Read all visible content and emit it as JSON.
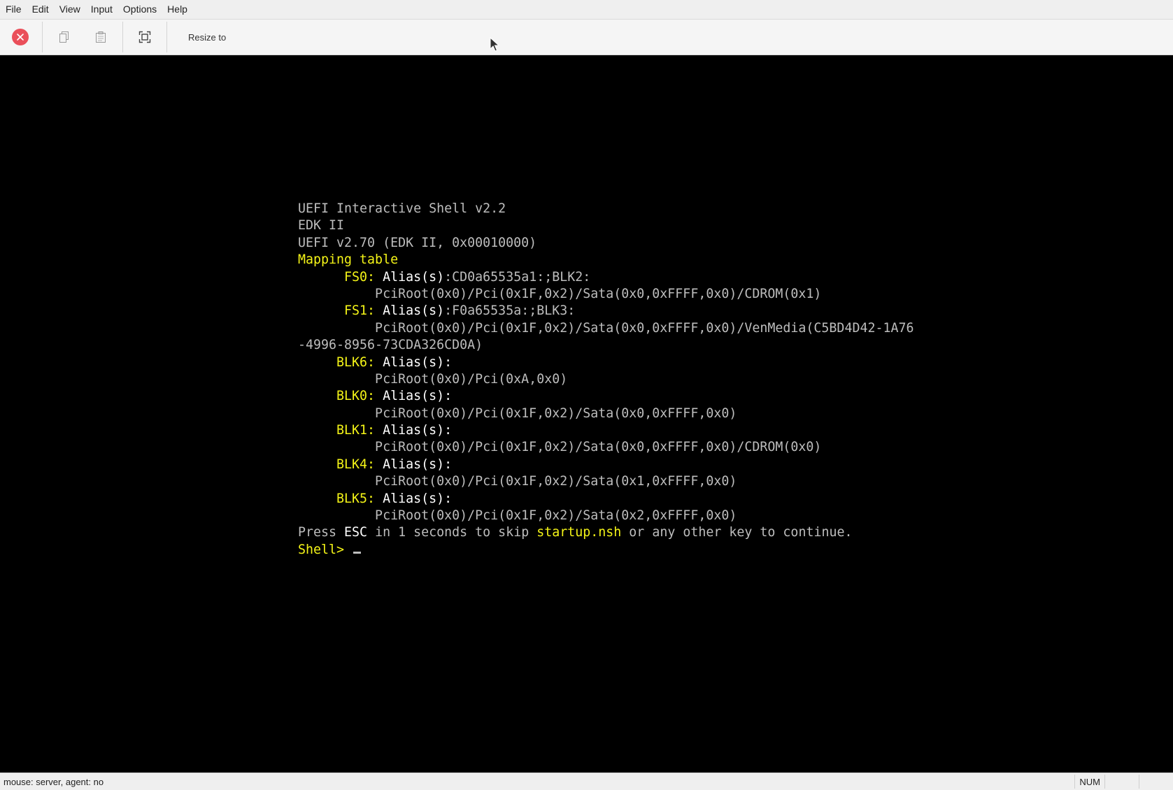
{
  "menubar": {
    "items": [
      "File",
      "Edit",
      "View",
      "Input",
      "Options",
      "Help"
    ]
  },
  "toolbar": {
    "resize_label": "Resize to"
  },
  "console": {
    "lines": [
      [
        {
          "t": "UEFI Interactive Shell v2.2",
          "c": "g"
        }
      ],
      [
        {
          "t": "EDK II",
          "c": "g"
        }
      ],
      [
        {
          "t": "UEFI v2.70 (EDK II, 0x00010000)",
          "c": "g"
        }
      ],
      [
        {
          "t": "Mapping table",
          "c": "y"
        }
      ],
      [
        {
          "t": "      FS0: ",
          "c": "y"
        },
        {
          "t": "Alias(s)",
          "c": "w"
        },
        {
          "t": ":CD0a65535a1:;BLK2:",
          "c": "g"
        }
      ],
      [
        {
          "t": "          PciRoot(0x0)/Pci(0x1F,0x2)/Sata(0x0,0xFFFF,0x0)/CDROM(0x1)",
          "c": "g"
        }
      ],
      [
        {
          "t": "      FS1: ",
          "c": "y"
        },
        {
          "t": "Alias(s)",
          "c": "w"
        },
        {
          "t": ":F0a65535a:;BLK3:",
          "c": "g"
        }
      ],
      [
        {
          "t": "          PciRoot(0x0)/Pci(0x1F,0x2)/Sata(0x0,0xFFFF,0x0)/VenMedia(C5BD4D42-1A76",
          "c": "g"
        }
      ],
      [
        {
          "t": "-4996-8956-73CDA326CD0A)",
          "c": "g"
        }
      ],
      [
        {
          "t": "     BLK6: ",
          "c": "y"
        },
        {
          "t": "Alias(s):",
          "c": "w"
        }
      ],
      [
        {
          "t": "          PciRoot(0x0)/Pci(0xA,0x0)",
          "c": "g"
        }
      ],
      [
        {
          "t": "     BLK0: ",
          "c": "y"
        },
        {
          "t": "Alias(s):",
          "c": "w"
        }
      ],
      [
        {
          "t": "          PciRoot(0x0)/Pci(0x1F,0x2)/Sata(0x0,0xFFFF,0x0)",
          "c": "g"
        }
      ],
      [
        {
          "t": "     BLK1: ",
          "c": "y"
        },
        {
          "t": "Alias(s):",
          "c": "w"
        }
      ],
      [
        {
          "t": "          PciRoot(0x0)/Pci(0x1F,0x2)/Sata(0x0,0xFFFF,0x0)/CDROM(0x0)",
          "c": "g"
        }
      ],
      [
        {
          "t": "     BLK4: ",
          "c": "y"
        },
        {
          "t": "Alias(s):",
          "c": "w"
        }
      ],
      [
        {
          "t": "          PciRoot(0x0)/Pci(0x1F,0x2)/Sata(0x1,0xFFFF,0x0)",
          "c": "g"
        }
      ],
      [
        {
          "t": "     BLK5: ",
          "c": "y"
        },
        {
          "t": "Alias(s):",
          "c": "w"
        }
      ],
      [
        {
          "t": "          PciRoot(0x0)/Pci(0x1F,0x2)/Sata(0x2,0xFFFF,0x0)",
          "c": "g"
        }
      ],
      [
        {
          "t": "Press ",
          "c": "g"
        },
        {
          "t": "ESC",
          "c": "w"
        },
        {
          "t": " in 1 seconds to skip ",
          "c": "g"
        },
        {
          "t": "startup.nsh",
          "c": "y"
        },
        {
          "t": " or any other key to continue.",
          "c": "g"
        }
      ]
    ],
    "prompt": "Shell> "
  },
  "statusbar": {
    "text": "mouse: server, agent:  no",
    "num_label": "NUM"
  },
  "colors": {
    "console_bg": "#000000",
    "console_text": "#bdbdbd",
    "console_highlight": "#f4f417",
    "console_bright": "#ffffff",
    "close_button": "#ea4f5a"
  },
  "icons": [
    "close-icon",
    "copy-icon",
    "paste-icon",
    "fullscreen-icon",
    "mouse-pointer-icon"
  ]
}
